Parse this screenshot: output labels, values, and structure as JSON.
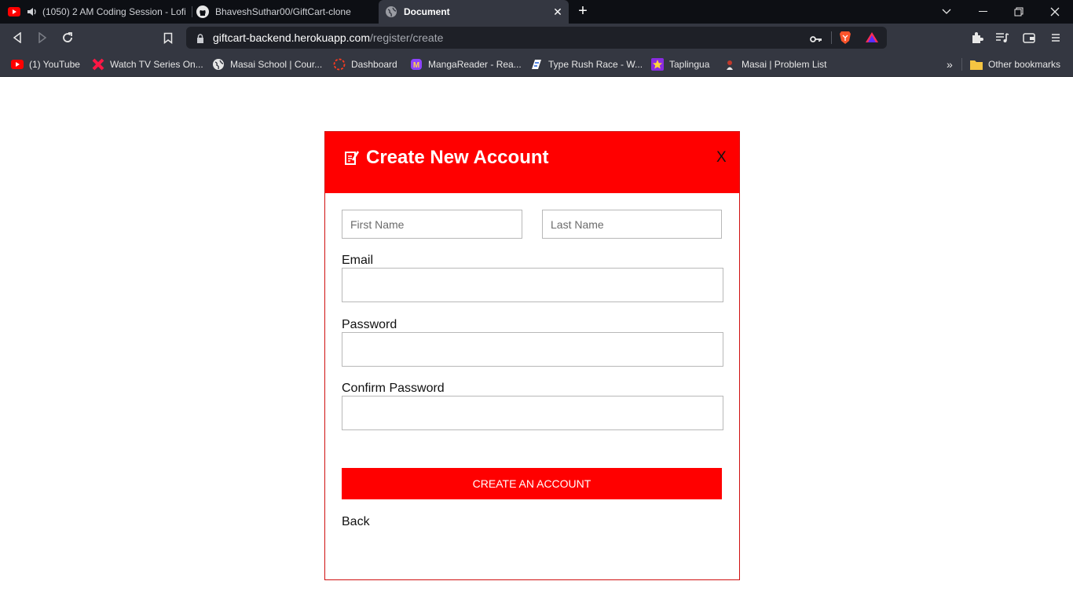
{
  "browser": {
    "tabs": [
      {
        "label": "(1050) 2 AM Coding Session - Lofi",
        "active": false
      },
      {
        "label": "BhaveshSuthar00/GiftCart-clone",
        "active": false
      },
      {
        "label": "Document",
        "active": true
      }
    ],
    "url": {
      "domain": "giftcart-backend.herokuapp.com",
      "path": "/register/create"
    },
    "bookmarks": [
      {
        "label": "(1) YouTube",
        "icon": "youtube-icon"
      },
      {
        "label": "Watch TV Series On...",
        "icon": "x-logo-icon"
      },
      {
        "label": "Masai School | Cour...",
        "icon": "globe-icon"
      },
      {
        "label": "Dashboard",
        "icon": "dashboard-icon"
      },
      {
        "label": "MangaReader - Rea...",
        "icon": "mangareader-icon"
      },
      {
        "label": "Type Rush Race - W...",
        "icon": "typerush-icon"
      },
      {
        "label": "Taplingua",
        "icon": "star-icon"
      },
      {
        "label": "Masai | Problem List",
        "icon": "masai-icon"
      }
    ],
    "other_bookmarks": "Other bookmarks",
    "overflow": "»"
  },
  "form": {
    "title": "Create New Account",
    "close_label": "X",
    "first_name_placeholder": "First Name",
    "last_name_placeholder": "Last Name",
    "email_label": "Email",
    "password_label": "Password",
    "confirm_password_label": "Confirm Password",
    "submit_label": "CREATE AN ACCOUNT",
    "back_label": "Back"
  },
  "colors": {
    "accent": "#ff0000",
    "chrome_dark": "#0d0f14",
    "chrome_toolbar": "#343741"
  }
}
